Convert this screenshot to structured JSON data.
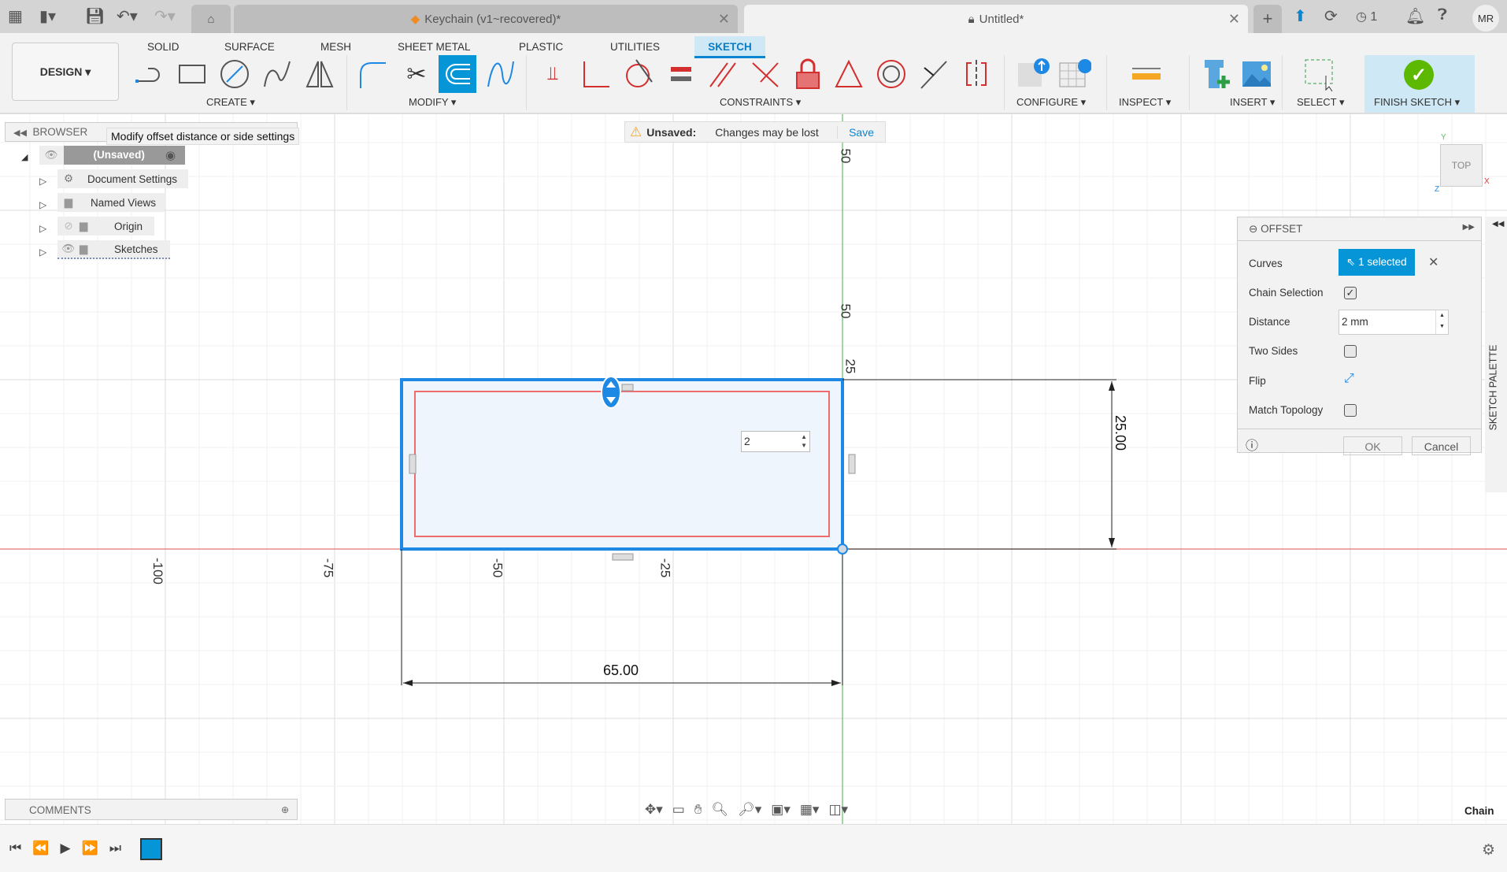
{
  "titlebar": {
    "doc_tab": "Keychain (v1~recovered)*",
    "active_tab": "Untitled*",
    "job_count": "1",
    "user_initials": "MR"
  },
  "toolbar": {
    "workspace": "DESIGN ▾",
    "tabs": [
      "SOLID",
      "SURFACE",
      "MESH",
      "SHEET METAL",
      "PLASTIC",
      "UTILITIES",
      "SKETCH"
    ],
    "active_tab": "SKETCH",
    "groups": {
      "create": "CREATE ▾",
      "modify": "MODIFY ▾",
      "constraints": "CONSTRAINTS ▾",
      "configure": "CONFIGURE ▾",
      "inspect": "INSPECT ▾",
      "insert": "INSERT ▾",
      "select": "SELECT ▾",
      "finish": "FINISH SKETCH ▾"
    }
  },
  "browser": {
    "title": "BROWSER",
    "tooltip": "Modify offset distance or side settings",
    "root": "(Unsaved)",
    "items": [
      "Document Settings",
      "Named Views",
      "Origin",
      "Sketches"
    ]
  },
  "unsaved_bar": {
    "label": "Unsaved:",
    "message": "Changes may be lost",
    "save": "Save"
  },
  "viewcube": {
    "face": "TOP",
    "axes": {
      "x": "X",
      "y": "Y",
      "z": "Z"
    }
  },
  "sketch": {
    "axis_ticks_x": [
      "-100",
      "-75",
      "-50",
      "-25"
    ],
    "axis_ticks_y": [
      "50",
      "25"
    ],
    "width_dim": "65.00",
    "height_dim": "25.00",
    "offset_input": "2"
  },
  "offset_panel": {
    "title": "OFFSET",
    "curves_label": "Curves",
    "curves_value": "1 selected",
    "chain_label": "Chain Selection",
    "chain_checked": true,
    "distance_label": "Distance",
    "distance_value": "2 mm",
    "two_sides_label": "Two Sides",
    "two_sides_checked": false,
    "flip_label": "Flip",
    "match_label": "Match Topology",
    "match_checked": false,
    "ok": "OK",
    "cancel": "Cancel"
  },
  "sketch_palette": "SKETCH PALETTE",
  "comments": "COMMENTS",
  "status": "Chain",
  "colors": {
    "accent": "#0696d7",
    "selection": "#1e88e5",
    "offset_curve": "#e57373",
    "x_axis": "#e53935",
    "y_axis": "#4caf50",
    "finish": "#5cb800"
  }
}
